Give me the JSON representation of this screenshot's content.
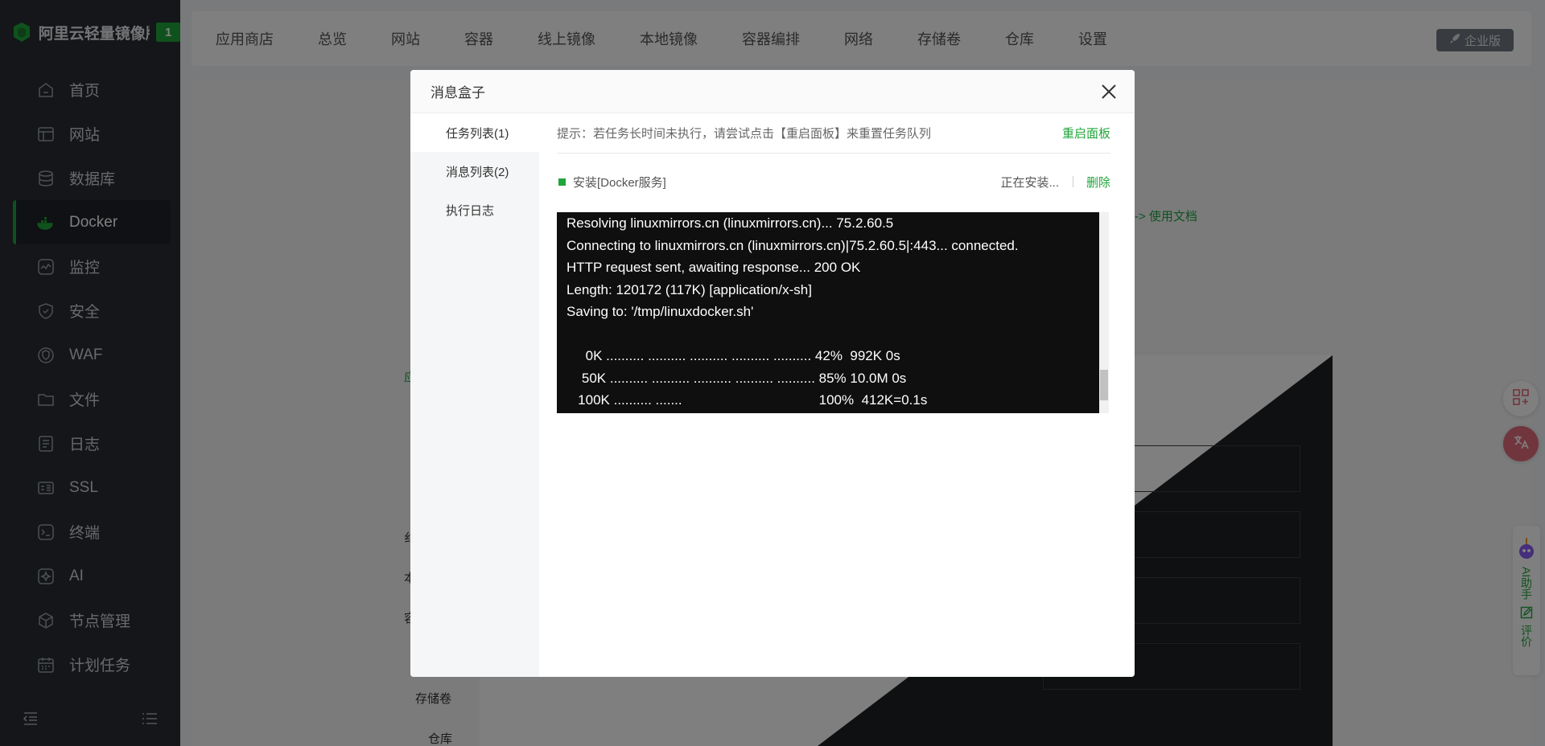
{
  "sidebar": {
    "brand": "阿里云轻量镜像版",
    "badge": "1",
    "items": [
      {
        "label": "首页",
        "icon": "home-icon"
      },
      {
        "label": "网站",
        "icon": "website-icon"
      },
      {
        "label": "数据库",
        "icon": "database-icon"
      },
      {
        "label": "Docker",
        "icon": "docker-icon",
        "active": true
      },
      {
        "label": "监控",
        "icon": "monitor-icon"
      },
      {
        "label": "安全",
        "icon": "shield-icon"
      },
      {
        "label": "WAF",
        "icon": "waf-icon"
      },
      {
        "label": "文件",
        "icon": "folder-icon"
      },
      {
        "label": "日志",
        "icon": "log-icon"
      },
      {
        "label": "SSL",
        "icon": "ssl-icon"
      },
      {
        "label": "终端",
        "icon": "terminal-icon"
      },
      {
        "label": "AI",
        "icon": "ai-icon"
      },
      {
        "label": "节点管理",
        "icon": "node-icon"
      },
      {
        "label": "计划任务",
        "icon": "calendar-icon"
      }
    ]
  },
  "topnav": [
    "应用商店",
    "总览",
    "网站",
    "容器",
    "线上镜像",
    "本地镜像",
    "容器编排",
    "网络",
    "存储卷",
    "仓库",
    "设置"
  ],
  "enterprise": "企业版",
  "background": {
    "doc_link": "-> 使用文档",
    "left_labels": [
      "应",
      "纟",
      "本",
      "容",
      "存储卷",
      "仓库"
    ],
    "ai_helper": "AI助手",
    "review": "评价"
  },
  "modal": {
    "title": "消息盒子",
    "tabs": [
      "任务列表(1)",
      "消息列表(2)",
      "执行日志"
    ],
    "tip": "提示：若任务长时间未执行，请尝试点击【重启面板】来重置任务队列",
    "restart": "重启面板",
    "task": {
      "name": "安装[Docker服务]",
      "status": "正在安装...",
      "delete": "删除"
    },
    "log": [
      "Resolving linuxmirrors.cn (linuxmirrors.cn)... 75.2.60.5",
      "Connecting to linuxmirrors.cn (linuxmirrors.cn)|75.2.60.5|:443... connected.",
      "HTTP request sent, awaiting response... 200 OK",
      "Length: 120172 (117K) [application/x-sh]",
      "Saving to: '/tmp/linuxdocker.sh'",
      "",
      "     0K .......... .......... .......... .......... .......... 42%  992K 0s",
      "    50K .......... .......... .......... .......... .......... 85% 10.0M 0s",
      "   100K .......... .......                                    100%  412K=0.1s"
    ]
  }
}
